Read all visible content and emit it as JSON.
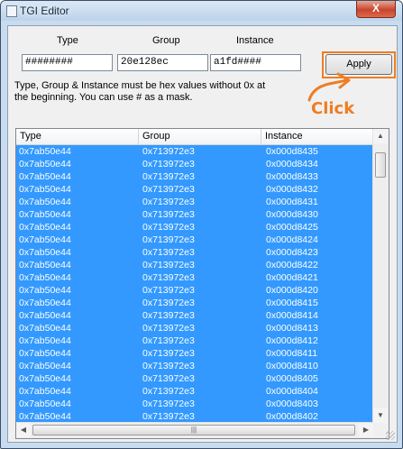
{
  "window": {
    "title": "TGI Editor",
    "close_glyph": "X"
  },
  "form": {
    "type_label": "Type",
    "group_label": "Group",
    "instance_label": "Instance",
    "type_value": "########",
    "group_value": "20e128ec",
    "instance_value": "a1fd####",
    "apply_label": "Apply",
    "hint_line1": "Type, Group & Instance must be hex values without 0x at",
    "hint_line2": "the beginning. You can use # as a mask."
  },
  "annotation": {
    "text": "Click",
    "color": "#ef7d22"
  },
  "list": {
    "columns": [
      "Type",
      "Group",
      "Instance"
    ],
    "selection_color": "#3399ff",
    "rows": [
      [
        "0x7ab50e44",
        "0x713972e3",
        "0x000d8435"
      ],
      [
        "0x7ab50e44",
        "0x713972e3",
        "0x000d8434"
      ],
      [
        "0x7ab50e44",
        "0x713972e3",
        "0x000d8433"
      ],
      [
        "0x7ab50e44",
        "0x713972e3",
        "0x000d8432"
      ],
      [
        "0x7ab50e44",
        "0x713972e3",
        "0x000d8431"
      ],
      [
        "0x7ab50e44",
        "0x713972e3",
        "0x000d8430"
      ],
      [
        "0x7ab50e44",
        "0x713972e3",
        "0x000d8425"
      ],
      [
        "0x7ab50e44",
        "0x713972e3",
        "0x000d8424"
      ],
      [
        "0x7ab50e44",
        "0x713972e3",
        "0x000d8423"
      ],
      [
        "0x7ab50e44",
        "0x713972e3",
        "0x000d8422"
      ],
      [
        "0x7ab50e44",
        "0x713972e3",
        "0x000d8421"
      ],
      [
        "0x7ab50e44",
        "0x713972e3",
        "0x000d8420"
      ],
      [
        "0x7ab50e44",
        "0x713972e3",
        "0x000d8415"
      ],
      [
        "0x7ab50e44",
        "0x713972e3",
        "0x000d8414"
      ],
      [
        "0x7ab50e44",
        "0x713972e3",
        "0x000d8413"
      ],
      [
        "0x7ab50e44",
        "0x713972e3",
        "0x000d8412"
      ],
      [
        "0x7ab50e44",
        "0x713972e3",
        "0x000d8411"
      ],
      [
        "0x7ab50e44",
        "0x713972e3",
        "0x000d8410"
      ],
      [
        "0x7ab50e44",
        "0x713972e3",
        "0x000d8405"
      ],
      [
        "0x7ab50e44",
        "0x713972e3",
        "0x000d8404"
      ],
      [
        "0x7ab50e44",
        "0x713972e3",
        "0x000d8403"
      ],
      [
        "0x7ab50e44",
        "0x713972e3",
        "0x000d8402"
      ]
    ]
  }
}
